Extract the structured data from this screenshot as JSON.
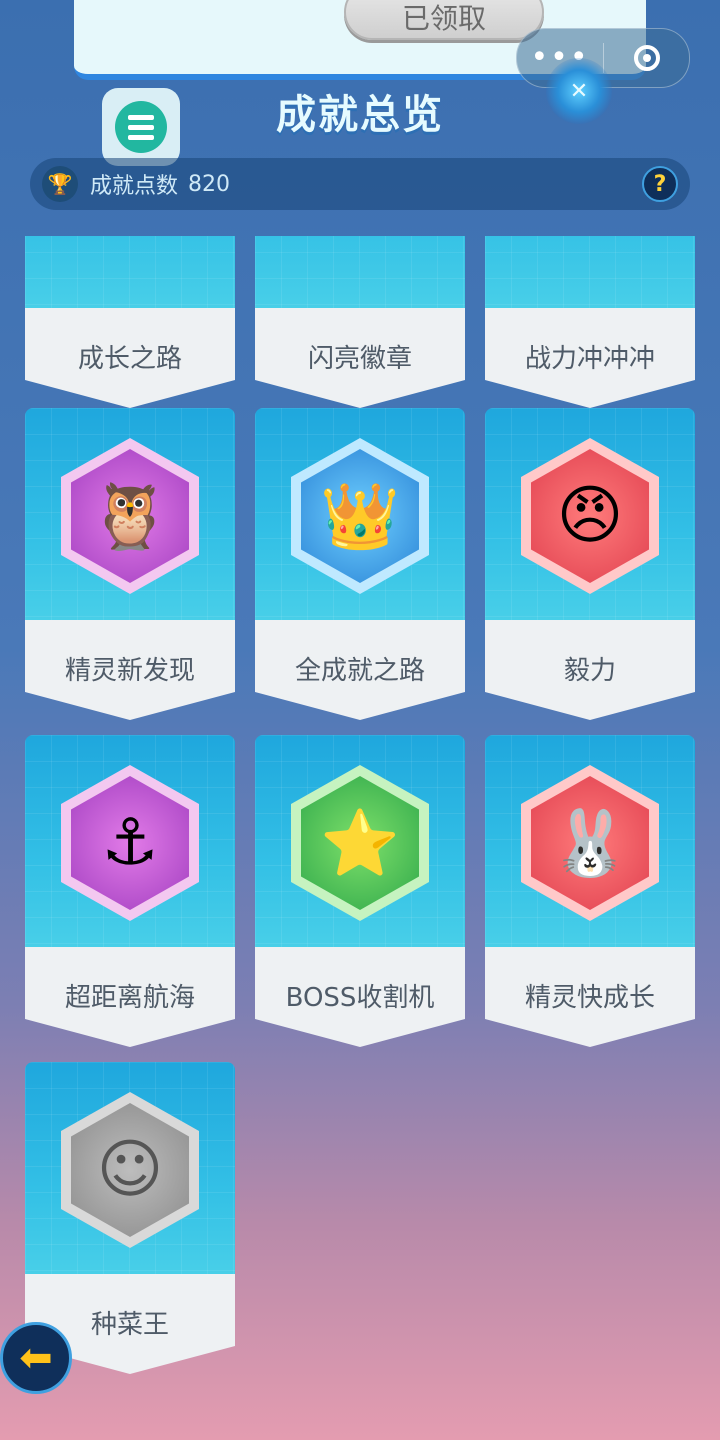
{
  "popup": {
    "claimed_label": "已领取"
  },
  "capsule": {
    "more_label": "•••"
  },
  "header": {
    "title": "成就总览",
    "points_label": "成就点数",
    "points_value": "820",
    "help_label": "?"
  },
  "partial_row": [
    "成长之路",
    "闪亮徽章",
    "战力冲冲冲"
  ],
  "cards": [
    {
      "label": "精灵新发现",
      "color": "purple",
      "icon": "owl-flame-icon",
      "glyph": "🦉"
    },
    {
      "label": "全成就之路",
      "color": "blue",
      "icon": "crown-wings-icon",
      "glyph": "👑"
    },
    {
      "label": "毅力",
      "color": "red",
      "icon": "warrior-face-icon",
      "glyph": "😠"
    },
    {
      "label": "超距离航海",
      "color": "purple",
      "icon": "captain-owl-icon",
      "glyph": "⚓"
    },
    {
      "label": "BOSS收割机",
      "color": "green",
      "icon": "boss-hero-icon",
      "glyph": "⭐"
    },
    {
      "label": "精灵快成长",
      "color": "red",
      "icon": "bunny-medal-icon",
      "glyph": "🐰"
    },
    {
      "label": "种菜王",
      "color": "gray",
      "icon": "farmer-hat-icon",
      "glyph": "☺"
    }
  ]
}
